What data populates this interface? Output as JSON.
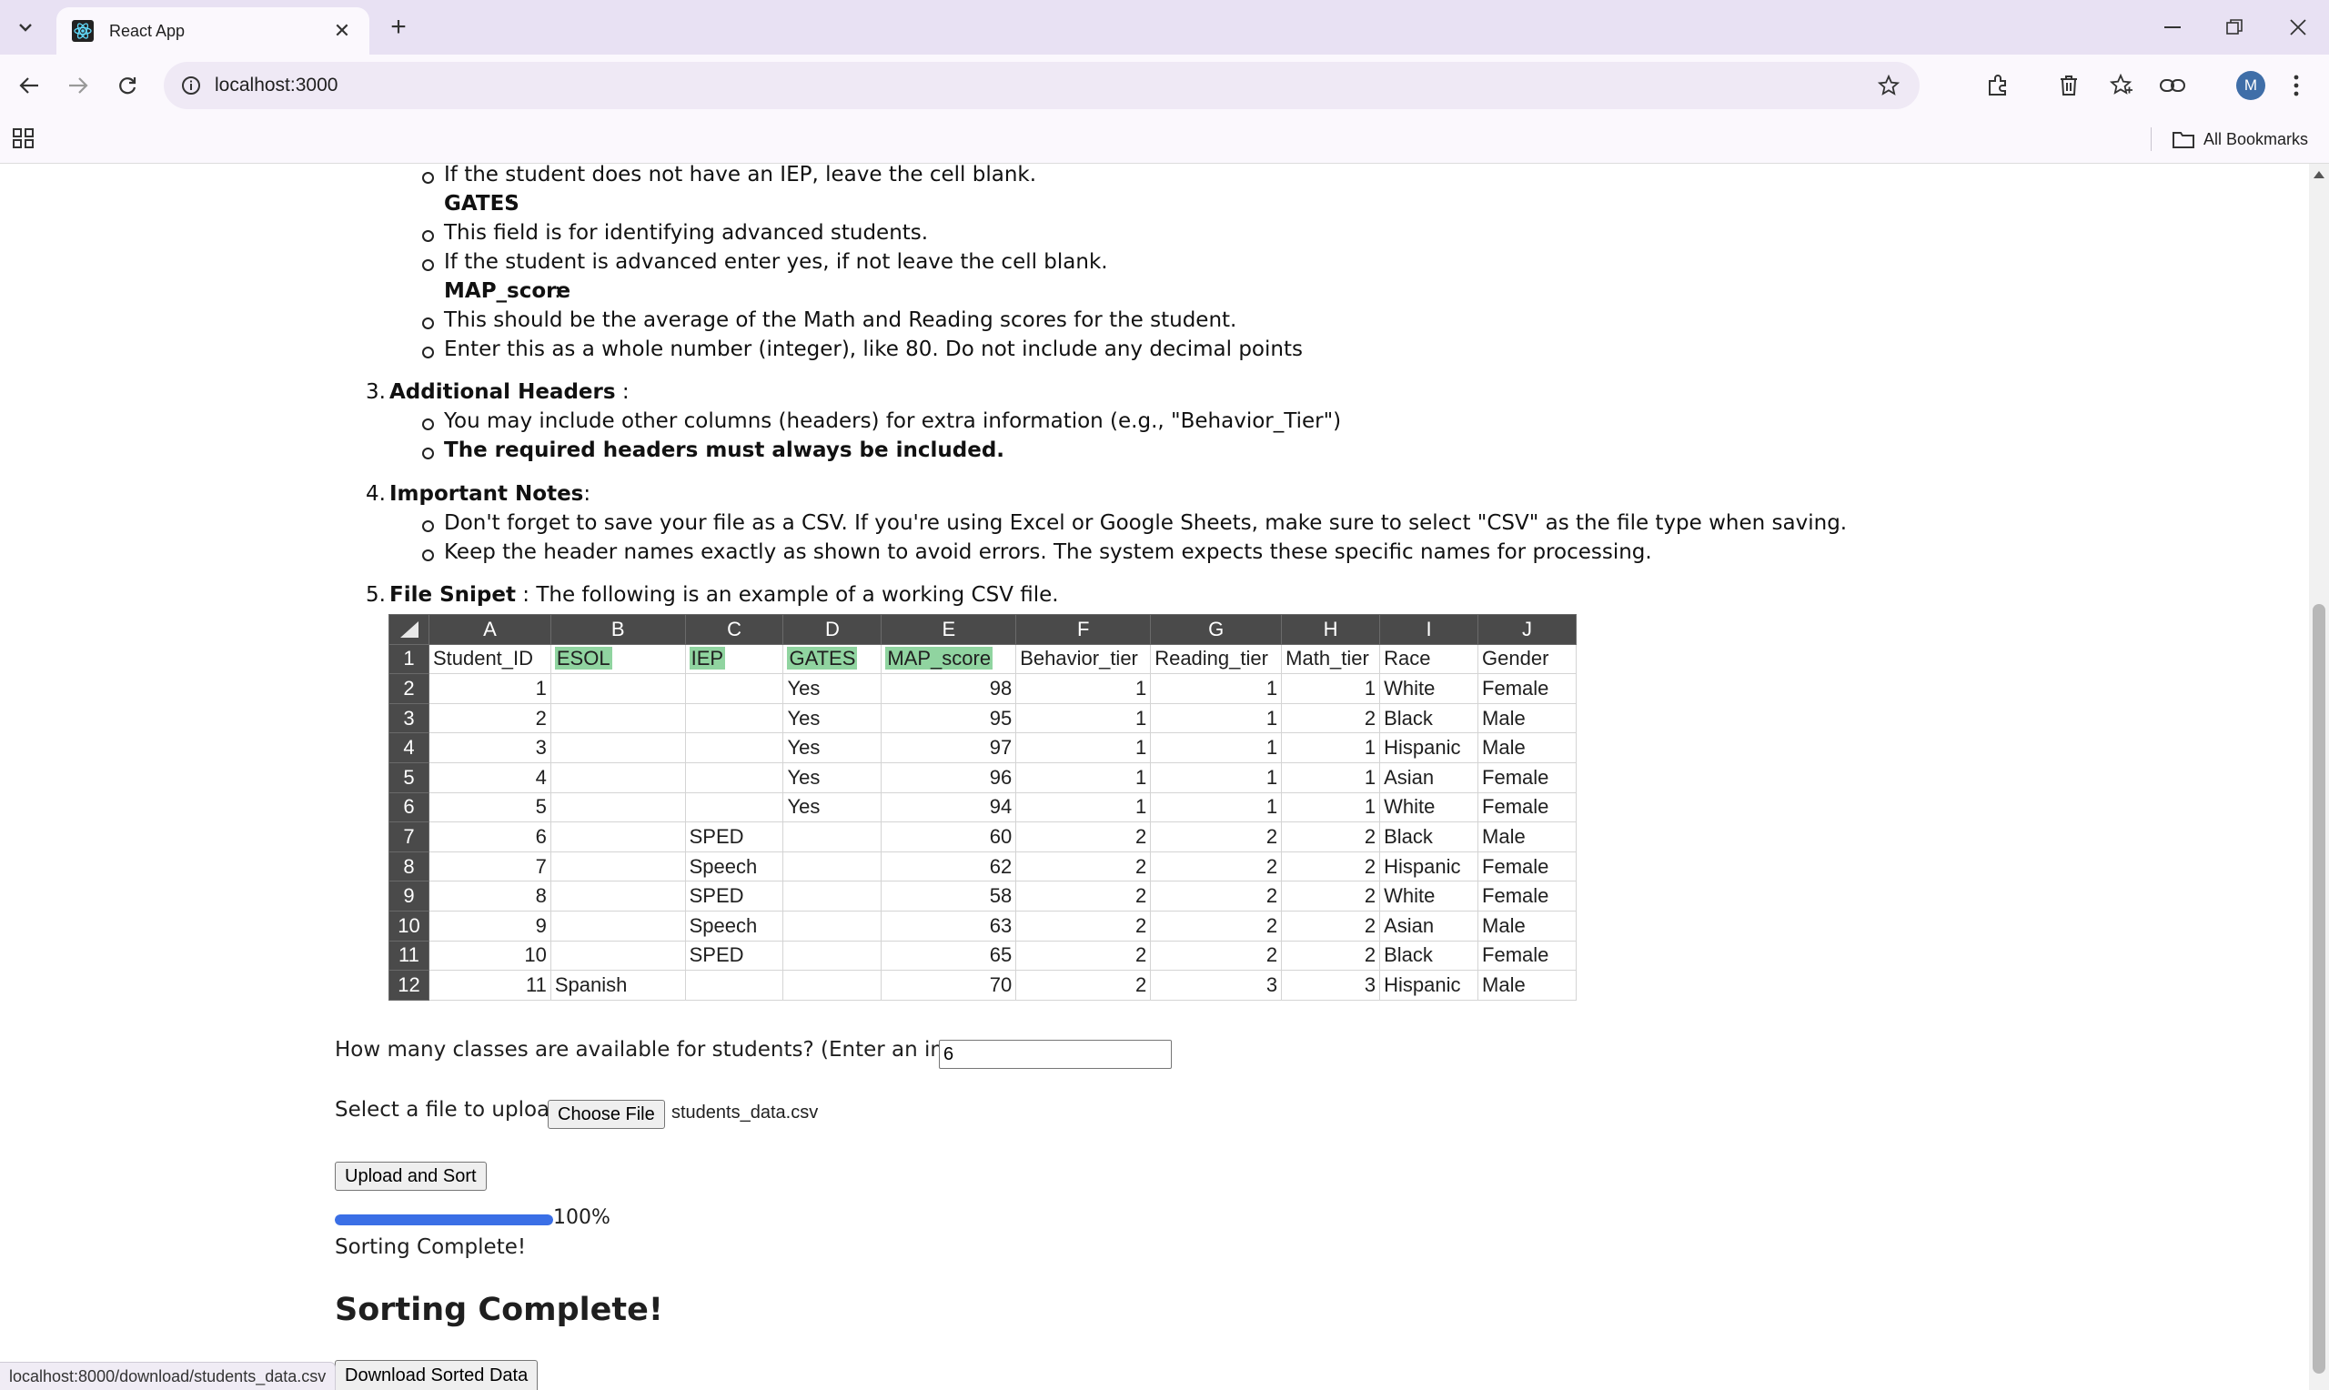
{
  "browser": {
    "tab_title": "React App",
    "url": "localhost:3000",
    "bookmarks_label": "All Bookmarks",
    "avatar_letter": "M",
    "status_url": "localhost:8000/download/students_data.csv"
  },
  "instructions": {
    "iep_blank_note": "If the student does not have an IEP, leave the cell blank.",
    "gates_label": "GATES",
    "gates_items": [
      "This field is for identifying advanced students.",
      "If the student is advanced enter yes, if not leave the cell blank."
    ],
    "map_label": "MAP_score",
    "map_items": [
      "This should be the average of the Math and Reading scores for the student.",
      "Enter this as a whole number (integer), like 80. Do not include any decimal points"
    ],
    "section3_number": "3.",
    "section3_title": "Additional Headers",
    "section3_suffix": " :",
    "section3_items": [
      "You may include other columns (headers) for extra information (e.g., \"Behavior_Tier\")",
      "The required headers must always be included."
    ],
    "section4_number": "4.",
    "section4_title": "Important Notes",
    "section4_suffix": ":",
    "section4_items": [
      "Don't forget to save your file as a CSV. If you're using Excel or Google Sheets, make sure to select \"CSV\" as the file type when saving.",
      "Keep the header names exactly as shown to avoid errors. The system expects these specific names for processing."
    ],
    "section5_number": "5.",
    "section5_title": "File Snipet",
    "section5_text": " : The following is an example of a working CSV file."
  },
  "sheet": {
    "columns": [
      "A",
      "B",
      "C",
      "D",
      "E",
      "F",
      "G",
      "H",
      "I",
      "J"
    ],
    "headers": [
      "Student_ID",
      "ESOL",
      "IEP",
      "GATES",
      "MAP_score",
      "Behavior_tier",
      "Reading_tier",
      "Math_tier",
      "Race",
      "Gender"
    ],
    "rows": [
      [
        "1",
        "",
        "",
        "Yes",
        "98",
        "1",
        "1",
        "1",
        "White",
        "Female"
      ],
      [
        "2",
        "",
        "",
        "Yes",
        "95",
        "1",
        "1",
        "2",
        "Black",
        "Male"
      ],
      [
        "3",
        "",
        "",
        "Yes",
        "97",
        "1",
        "1",
        "1",
        "Hispanic",
        "Male"
      ],
      [
        "4",
        "",
        "",
        "Yes",
        "96",
        "1",
        "1",
        "1",
        "Asian",
        "Female"
      ],
      [
        "5",
        "",
        "",
        "Yes",
        "94",
        "1",
        "1",
        "1",
        "White",
        "Female"
      ],
      [
        "6",
        "",
        "SPED",
        "",
        "60",
        "2",
        "2",
        "2",
        "Black",
        "Male"
      ],
      [
        "7",
        "",
        "Speech",
        "",
        "62",
        "2",
        "2",
        "2",
        "Hispanic",
        "Female"
      ],
      [
        "8",
        "",
        "SPED",
        "",
        "58",
        "2",
        "2",
        "2",
        "White",
        "Female"
      ],
      [
        "9",
        "",
        "Speech",
        "",
        "63",
        "2",
        "2",
        "2",
        "Asian",
        "Male"
      ],
      [
        "10",
        "",
        "SPED",
        "",
        "65",
        "2",
        "2",
        "2",
        "Black",
        "Female"
      ],
      [
        "11",
        "Spanish",
        "",
        "",
        "70",
        "2",
        "3",
        "3",
        "Hispanic",
        "Male"
      ]
    ]
  },
  "form": {
    "classes_label": "How many classes are available for students? (Enter an integer)",
    "classes_value": "6",
    "file_label": "Select a file to upload:",
    "choose_file_label": "Choose File",
    "file_name": "students_data.csv",
    "upload_label": "Upload and Sort",
    "progress_percent": 100,
    "progress_text": "100%",
    "status_text": "Sorting Complete!",
    "heading": "Sorting Complete!",
    "download_label": "Download Sorted Data"
  },
  "colors": {
    "accent": "#3a6fe6",
    "highlight": "#90d4a0",
    "sheet_header": "#4a4a4a"
  }
}
